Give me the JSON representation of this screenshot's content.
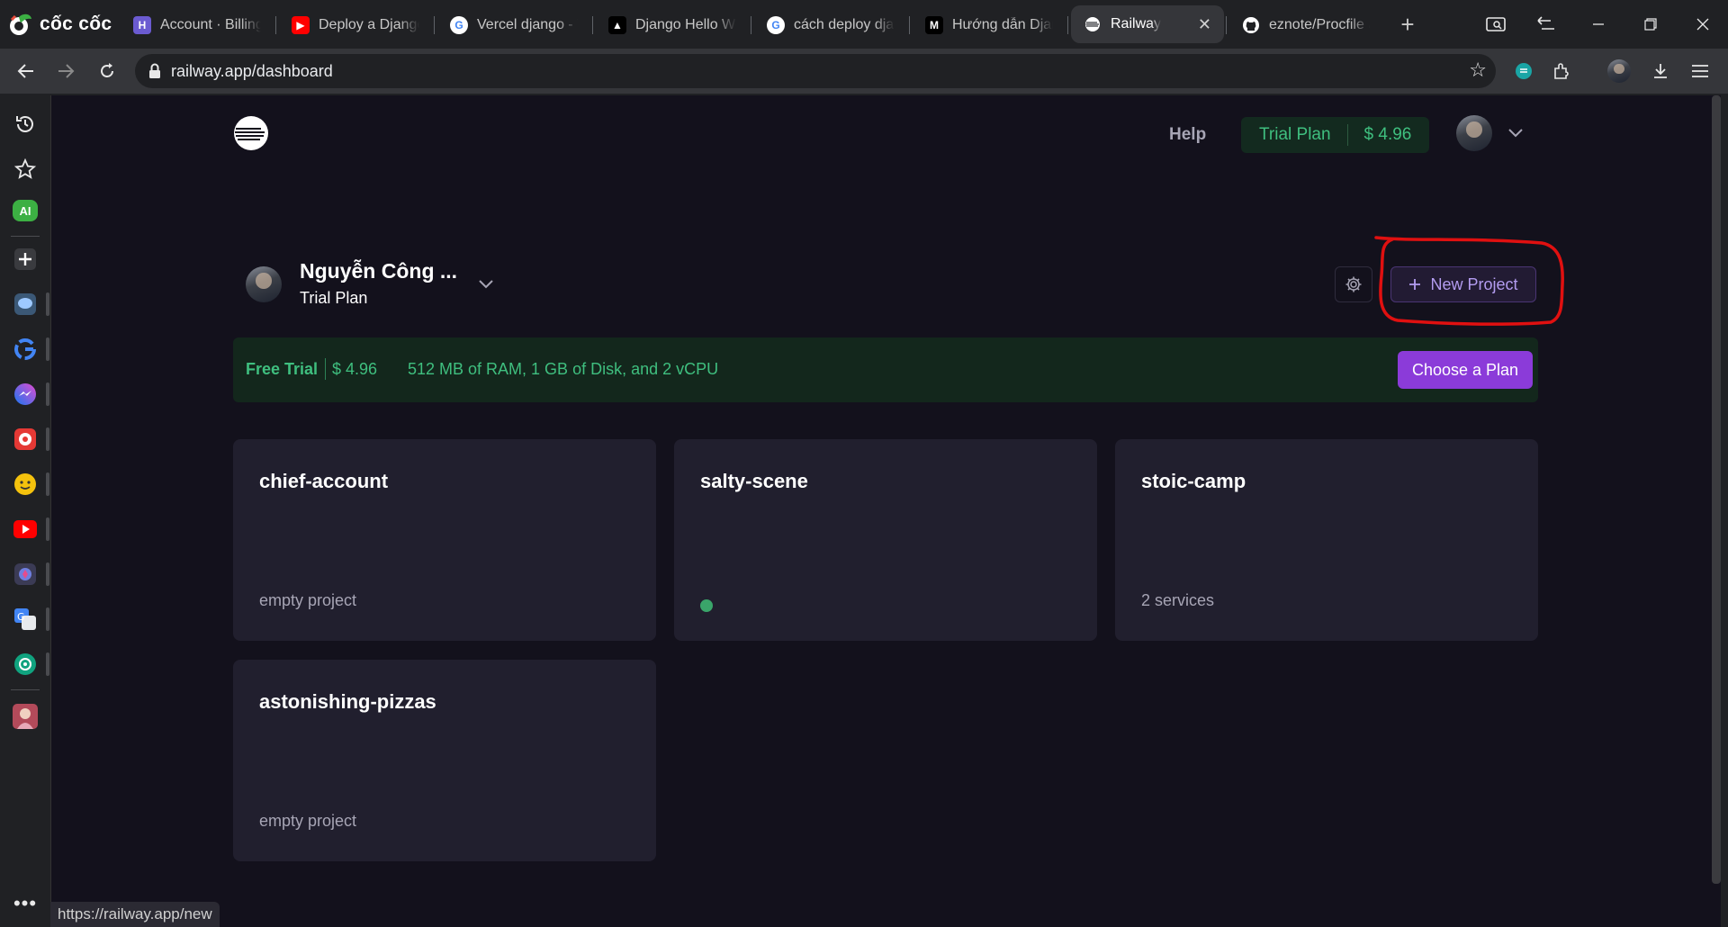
{
  "browser": {
    "brand_name": "cốc cốc",
    "tabs": [
      {
        "label": "Account · Billing | (",
        "favicon": "heroku-icon",
        "color": "#6b5bd1",
        "glyph": "H"
      },
      {
        "label": "Deploy a Django v",
        "favicon": "youtube-icon",
        "color": "#ff0000",
        "glyph": "▶"
      },
      {
        "label": "Vercel django - Tìm",
        "favicon": "google-icon",
        "color": "#ffffff",
        "glyph": "G"
      },
      {
        "label": "Django Hello Worl",
        "favicon": "vercel-icon",
        "color": "#000000",
        "glyph": "▲"
      },
      {
        "label": "cách deploy djang",
        "favicon": "google-icon",
        "color": "#ffffff",
        "glyph": "G"
      },
      {
        "label": "Hướng dẫn Djang",
        "favicon": "medium-icon",
        "color": "#000000",
        "glyph": "M"
      },
      {
        "label": "Railway",
        "favicon": "railway-icon",
        "color": "#ffffff",
        "glyph": ""
      },
      {
        "label": "eznote/Procfile at",
        "favicon": "github-icon",
        "color": "#ffffff",
        "glyph": ""
      }
    ],
    "url": "railway.app/dashboard",
    "status_url": "https://railway.app/new"
  },
  "header": {
    "help_label": "Help",
    "plan_label": "Trial Plan",
    "plan_balance": "$ 4.96"
  },
  "team": {
    "name": "Nguyễn Công ...",
    "plan": "Trial Plan",
    "new_project_label": "New Project"
  },
  "trial_banner": {
    "title": "Free Trial",
    "balance": "$ 4.96",
    "resources": "512 MB of RAM, 1 GB of Disk, and 2 vCPU",
    "choose_label": "Choose a Plan"
  },
  "projects": [
    {
      "name": "chief-account",
      "subtitle": "empty project",
      "status": "text"
    },
    {
      "name": "salty-scene",
      "subtitle": "",
      "status": "active-dot"
    },
    {
      "name": "stoic-camp",
      "subtitle": "2 services",
      "status": "text"
    },
    {
      "name": "astonishing-pizzas",
      "subtitle": "empty project",
      "status": "text"
    }
  ],
  "colors": {
    "accent_purple": "#8b3bd9",
    "success_green": "#3fbf7f",
    "annotation_red": "#e01010"
  }
}
